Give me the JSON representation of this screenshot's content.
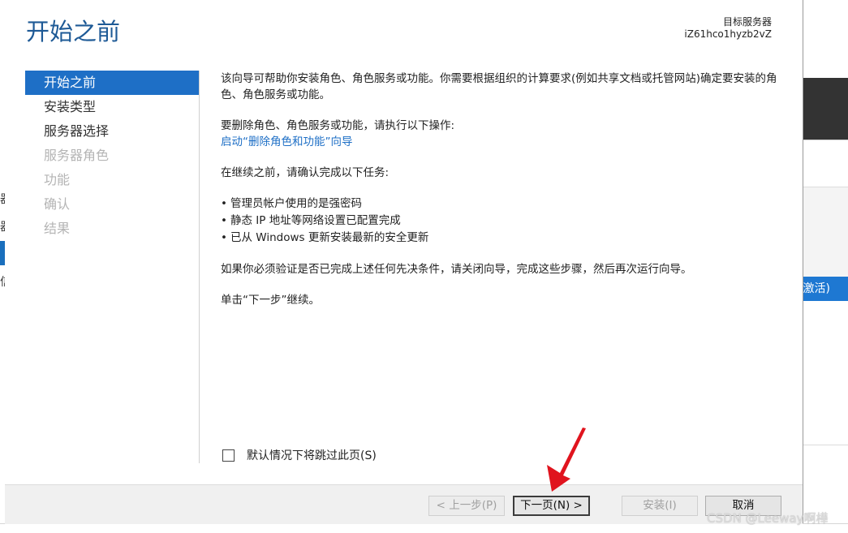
{
  "window": {
    "title": "开始之前",
    "target_server_label": "目标服务器",
    "target_server_name": "iZ61hco1hyzb2vZ"
  },
  "sidebar": {
    "items": [
      {
        "label": "开始之前",
        "state": "active"
      },
      {
        "label": "安装类型",
        "state": "enabled"
      },
      {
        "label": "服务器选择",
        "state": "enabled"
      },
      {
        "label": "服务器角色",
        "state": "disabled"
      },
      {
        "label": "功能",
        "state": "disabled"
      },
      {
        "label": "确认",
        "state": "disabled"
      },
      {
        "label": "结果",
        "state": "disabled"
      }
    ]
  },
  "content": {
    "intro": "该向导可帮助你安装角色、角色服务或功能。你需要根据组织的计算要求(例如共享文档或托管网站)确定要安装的角色、角色服务或功能。",
    "remove_heading": "要删除角色、角色服务或功能，请执行以下操作:",
    "remove_link": "启动“删除角色和功能”向导",
    "confirm_heading": "在继续之前，请确认完成以下任务:",
    "tasks": [
      "管理员帐户使用的是强密码",
      "静态 IP 地址等网络设置已配置完成",
      "已从 Windows 更新安装最新的安全更新"
    ],
    "verify_note": "如果你必须验证是否已完成上述任何先决条件，请关闭向导，完成这些步骤，然后再次运行向导。",
    "click_next": "单击“下一步”继续。"
  },
  "skip_checkbox": {
    "label": "默认情况下将跳过此页(S)",
    "checked": false
  },
  "buttons": {
    "prev": "< 上一步(P)",
    "next": "下一页(N) >",
    "install": "安装(I)",
    "cancel": "取消"
  },
  "background": {
    "left_glyphs": [
      "器",
      "器",
      "信"
    ],
    "right_blue_text": "激活)"
  },
  "watermark": "CSDN @Leeway啊樺",
  "colors": {
    "title_blue": "#1e5a96",
    "active_nav": "#1e6fc6",
    "link": "#1e6fc6",
    "arrow_red": "#e0141e"
  }
}
